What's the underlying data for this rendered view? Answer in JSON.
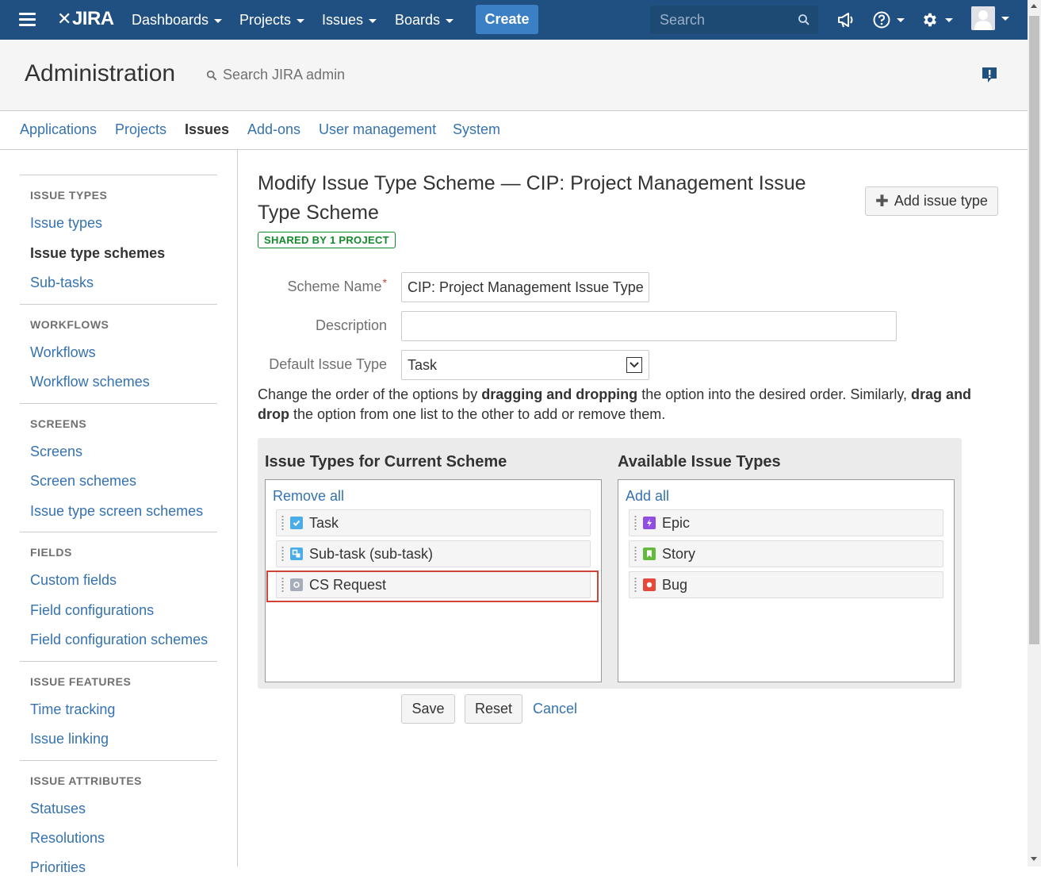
{
  "topnav": {
    "logo": "JIRA",
    "menus": [
      "Dashboards",
      "Projects",
      "Issues",
      "Boards"
    ],
    "create_label": "Create",
    "search_placeholder": "Search",
    "icons": [
      "hamburger-icon",
      "megaphone-icon",
      "help-icon",
      "gear-icon",
      "avatar"
    ],
    "bg_color": "#205081"
  },
  "admin": {
    "title": "Administration",
    "search_label": "Search JIRA admin",
    "tabs": [
      "Applications",
      "Projects",
      "Issues",
      "Add-ons",
      "User management",
      "System"
    ],
    "active_tab": "Issues"
  },
  "sidebar": {
    "sections": [
      {
        "heading": "ISSUE TYPES",
        "items": [
          "Issue types",
          "Issue type schemes",
          "Sub-tasks"
        ]
      },
      {
        "heading": "WORKFLOWS",
        "items": [
          "Workflows",
          "Workflow schemes"
        ]
      },
      {
        "heading": "SCREENS",
        "items": [
          "Screens",
          "Screen schemes",
          "Issue type screen schemes"
        ]
      },
      {
        "heading": "FIELDS",
        "items": [
          "Custom fields",
          "Field configurations",
          "Field configuration schemes"
        ]
      },
      {
        "heading": "ISSUE FEATURES",
        "items": [
          "Time tracking",
          "Issue linking"
        ]
      },
      {
        "heading": "ISSUE ATTRIBUTES",
        "items": [
          "Statuses",
          "Resolutions",
          "Priorities"
        ]
      }
    ],
    "active_item": "Issue type schemes"
  },
  "main": {
    "title": "Modify Issue Type Scheme — CIP: Project Management Issue Type Scheme",
    "shared_badge": "SHARED BY 1 PROJECT",
    "add_issue_type_label": "Add issue type",
    "form": {
      "scheme_name_label": "Scheme Name",
      "scheme_name_value": "CIP: Project Management Issue Type Scheme",
      "description_label": "Description",
      "description_value": "",
      "default_issue_type_label": "Default Issue Type",
      "default_issue_type_value": "Task"
    },
    "help": {
      "part1": "Change the order of the options by ",
      "bold1": "dragging and dropping",
      "part2": " the option into the desired order. Similarly, ",
      "bold2": "drag and drop",
      "part3": " the option from one list to the other to add or remove them."
    },
    "current": {
      "heading": "Issue Types for Current Scheme",
      "action": "Remove all",
      "items": [
        {
          "label": "Task",
          "icon": "task-icon",
          "color": "#4bade8"
        },
        {
          "label": "Sub-task (sub-task)",
          "icon": "subtask-icon",
          "color": "#4bade8"
        },
        {
          "label": "CS Request",
          "icon": "cs-request-icon",
          "color": "#a5adba"
        }
      ]
    },
    "available": {
      "heading": "Available Issue Types",
      "action": "Add all",
      "items": [
        {
          "label": "Epic",
          "icon": "epic-icon",
          "color": "#904ee2"
        },
        {
          "label": "Story",
          "icon": "story-icon",
          "color": "#63ba3c"
        },
        {
          "label": "Bug",
          "icon": "bug-icon",
          "color": "#e5493a"
        }
      ]
    },
    "buttons": {
      "save": "Save",
      "reset": "Reset",
      "cancel": "Cancel"
    }
  }
}
